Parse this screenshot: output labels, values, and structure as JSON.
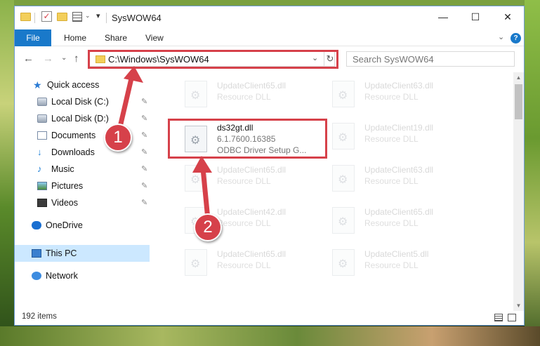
{
  "window": {
    "title": "SysWOW64",
    "minimize_glyph": "—",
    "maximize_glyph": "☐",
    "close_glyph": "✕"
  },
  "ribbon": {
    "tabs": [
      "File",
      "Home",
      "Share",
      "View"
    ],
    "expand_glyph": "⌄",
    "help_glyph": "?"
  },
  "nav": {
    "back_glyph": "←",
    "forward_glyph": "→",
    "recent_glyph": "⌄",
    "up_glyph": "↑",
    "address": "C:\\Windows\\SysWOW64",
    "address_dropdown_glyph": "⌄",
    "refresh_glyph": "↻",
    "search_placeholder": "Search SysWOW64"
  },
  "navpane": {
    "quick_access": "Quick access",
    "items": [
      {
        "label": "Local Disk (C:)",
        "icon": "drive-icon"
      },
      {
        "label": "Local Disk (D:)",
        "icon": "drive-icon"
      },
      {
        "label": "Documents",
        "icon": "documents-icon"
      },
      {
        "label": "Downloads",
        "icon": "downloads-icon"
      },
      {
        "label": "Music",
        "icon": "music-icon"
      },
      {
        "label": "Pictures",
        "icon": "pictures-icon"
      },
      {
        "label": "Videos",
        "icon": "videos-icon"
      }
    ],
    "pin_glyph": "📌",
    "onedrive": "OneDrive",
    "this_pc": "This PC",
    "network": "Network"
  },
  "files": [
    {
      "name": "UpdateClient65.dll",
      "type": "Resource DLL"
    },
    {
      "name": "UpdateClient63.dll",
      "type": "Resource DLL"
    },
    {
      "name": "ds32gt.dll",
      "version": "6.1.7600.16385",
      "type": "ODBC Driver Setup G..."
    },
    {
      "name": "UpdateClient19.dll",
      "type": "Resource DLL"
    },
    {
      "name": "UpdateClient65.dll",
      "type": "Resource DLL"
    },
    {
      "name": "UpdateClient63.dll",
      "type": "Resource DLL"
    },
    {
      "name": "UpdateClient42.dll",
      "type": "Resource DLL"
    },
    {
      "name": "UpdateClient65.dll",
      "type": "Resource DLL"
    },
    {
      "name": "UpdateClient65.dll",
      "type": "Resource DLL"
    },
    {
      "name": "UpdateClient5.dll",
      "type": "Resource DLL"
    }
  ],
  "status": {
    "item_count": "192 items"
  },
  "annotations": {
    "step1": "1",
    "step2": "2",
    "highlight_color": "#d6414a"
  }
}
